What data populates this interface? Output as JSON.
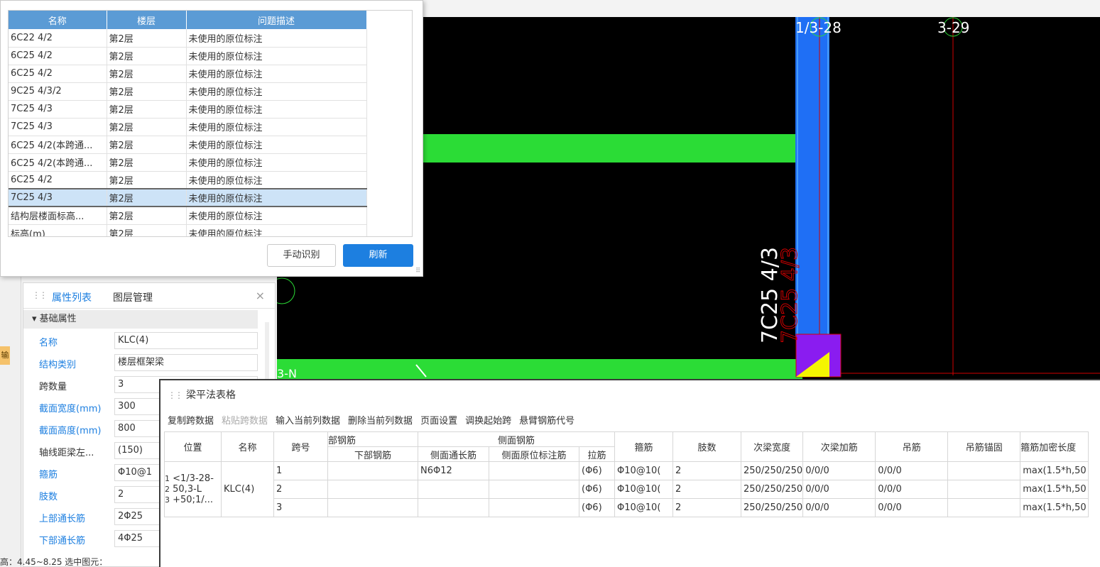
{
  "issues": {
    "columns": [
      "名称",
      "楼层",
      "问题描述"
    ],
    "rows": [
      [
        "6C22 4/2",
        "第2层",
        "未使用的原位标注"
      ],
      [
        "6C25 4/2",
        "第2层",
        "未使用的原位标注"
      ],
      [
        "6C25 4/2",
        "第2层",
        "未使用的原位标注"
      ],
      [
        "9C25 4/3/2",
        "第2层",
        "未使用的原位标注"
      ],
      [
        "7C25 4/3",
        "第2层",
        "未使用的原位标注"
      ],
      [
        "7C25 4/3",
        "第2层",
        "未使用的原位标注"
      ],
      [
        "6C25 4/2(本跨通...",
        "第2层",
        "未使用的原位标注"
      ],
      [
        "6C25 4/2(本跨通...",
        "第2层",
        "未使用的原位标注"
      ],
      [
        "6C25 4/2",
        "第2层",
        "未使用的原位标注"
      ],
      [
        "7C25 4/3",
        "第2层",
        "未使用的原位标注"
      ],
      [
        "结构层楼面标高...",
        "第2层",
        "未使用的原位标注"
      ],
      [
        "标高(m)",
        "第2层",
        "未使用的原位标注"
      ]
    ],
    "selected_index": 9,
    "manual_button": "手动识别",
    "refresh_button": "刷新"
  },
  "properties": {
    "tabs": [
      "属性列表",
      "图层管理"
    ],
    "group": "基础属性",
    "rows": [
      {
        "label": "名称",
        "value": "KLC(4)",
        "blue": true
      },
      {
        "label": "结构类别",
        "value": "楼层框架梁",
        "blue": true
      },
      {
        "label": "跨数量",
        "value": "3",
        "blue": false
      },
      {
        "label": "截面宽度(mm)",
        "value": "300",
        "blue": true
      },
      {
        "label": "截面高度(mm)",
        "value": "800",
        "blue": true
      },
      {
        "label": "轴线距梁左...",
        "value": "(150)",
        "blue": false
      },
      {
        "label": "箍筋",
        "value": "Φ10@1",
        "blue": true
      },
      {
        "label": "肢数",
        "value": "2",
        "blue": true
      },
      {
        "label": "上部通长筋",
        "value": "2Φ25",
        "blue": true
      },
      {
        "label": "下部通长筋",
        "value": "4Φ25",
        "blue": true
      }
    ]
  },
  "beam": {
    "title": "梁平法表格",
    "toolbar": [
      "复制跨数据",
      "粘贴跨数据",
      "输入当前列数据",
      "删除当前列数据",
      "页面设置",
      "调换起始跨",
      "悬臂钢筋代号"
    ],
    "header": {
      "position": "位置",
      "name": "名称",
      "span": "跨号",
      "group_rebar": "部钢筋",
      "bottom_rebar": "下部钢筋",
      "group_side": "侧面钢筋",
      "side_long": "侧面通长筋",
      "side_orig": "侧面原位标注筋",
      "tie": "拉筋",
      "stirrup": "箍筋",
      "legs": "肢数",
      "sec_width": "次梁宽度",
      "sec_add": "次梁加筋",
      "hanger": "吊筋",
      "hanger_anchor": "吊筋锚固",
      "dense_len": "箍筋加密长度"
    },
    "position_text": [
      "<1/3-28-",
      "50,3-L",
      "+50;1/..."
    ],
    "row_numbers": [
      "1",
      "2",
      "3"
    ],
    "name_value": "KLC(4)",
    "rows": [
      {
        "span": "1",
        "side_long": "N6Φ12",
        "tie": "(Φ6)",
        "stirrup": "Φ10@10(",
        "legs": "2",
        "sec_width": "250/250/250",
        "sec_add": "0/0/0",
        "hanger": "0/0/0",
        "dense": "max(1.5*h,50"
      },
      {
        "span": "2",
        "side_long": "",
        "tie": "(Φ6)",
        "stirrup": "Φ10@10(",
        "legs": "2",
        "sec_width": "250/250/250",
        "sec_add": "0/0/0",
        "hanger": "0/0/0",
        "dense": "max(1.5*h,50"
      },
      {
        "span": "3",
        "side_long": "",
        "tie": "(Φ6)",
        "stirrup": "Φ10@10(",
        "legs": "2",
        "sec_width": "250/250/250",
        "sec_add": "0/0/0",
        "hanger": "0/0/0",
        "dense": "max(1.5*h,50"
      }
    ]
  },
  "cad": {
    "axis_labels": [
      "1/3-28",
      "3-29",
      "3-N"
    ],
    "beam_text": "7C25 4/3",
    "colors": {
      "beam_green": "#2bdc36",
      "column_blue": "#1f6ff5",
      "grid_red": "#d10000",
      "purple": "#8a1cf0",
      "yellow": "#f5f500"
    }
  },
  "side_tab": "输",
  "status": "高：4.45~8.25      选中图元："
}
